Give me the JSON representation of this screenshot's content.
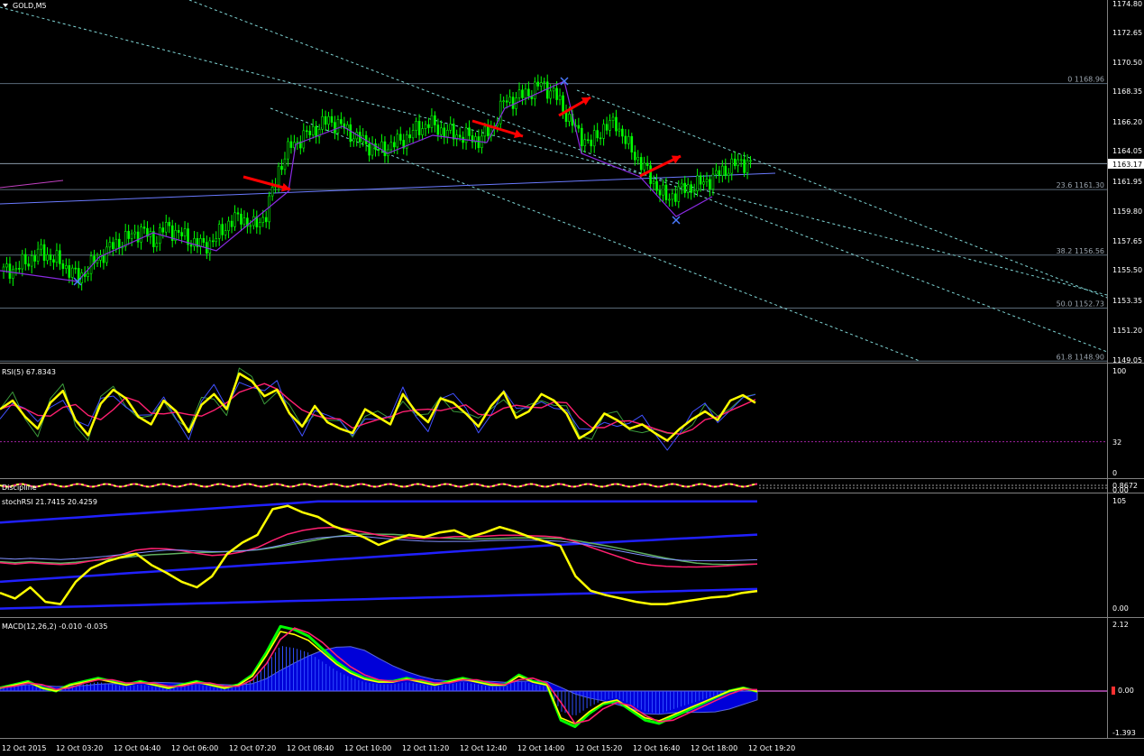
{
  "symbol_label": "GOLD,M5",
  "panels": {
    "main": {
      "price_axis": [
        "1174.80",
        "1172.65",
        "1170.50",
        "1168.35",
        "1166.20",
        "1164.05",
        "1161.95",
        "1159.80",
        "1157.65",
        "1155.50",
        "1153.35",
        "1151.20",
        "1149.05"
      ],
      "current_price": "1163.17",
      "fib_labels": [
        "0 1168.96",
        "23.6 1161.30",
        "38.2 1156.56",
        "50.0 1152.73",
        "61.8 1148.90"
      ]
    },
    "rsi": {
      "title": "RSI(5) 67.8343",
      "axis": [
        "100",
        "32",
        "0"
      ]
    },
    "strip": {
      "label": "Discipline",
      "axis": [
        "0.8672",
        "0.00"
      ]
    },
    "stoch": {
      "title": "stochRSI 21.7415 20.4259",
      "axis": [
        "105",
        "0.00"
      ]
    },
    "macd": {
      "title": "MACD(12,26,2) -0.010 -0.035",
      "axis": [
        "2.12",
        "0.00",
        "-1.393"
      ]
    }
  },
  "time_axis": [
    "12 Oct 2015",
    "12 Oct 03:20",
    "12 Oct 04:40",
    "12 Oct 06:00",
    "12 Oct 07:20",
    "12 Oct 08:40",
    "12 Oct 10:00",
    "12 Oct 11:20",
    "12 Oct 12:40",
    "12 Oct 14:00",
    "12 Oct 15:20",
    "12 Oct 16:40",
    "12 Oct 18:00",
    "12 Oct 19:20"
  ],
  "colors": {
    "up_candle": "#00ff00",
    "zigzag": "#8a2be2",
    "arrow": "#ff0000",
    "channel": "#7fd4d4",
    "rsi_main": "#ffff00",
    "macd_hist": "#0000ff"
  },
  "chart_data": [
    {
      "type": "candlestick",
      "series": [
        {
          "name": "GOLD,M5",
          "values": [
            1155.4,
            1155.6,
            1156.2,
            1156.8,
            1156.3,
            1155.7,
            1154.9,
            1155.8,
            1156.7,
            1157.4,
            1157.8,
            1158.4,
            1157.6,
            1158.6,
            1158.1,
            1157.6,
            1157.2,
            1157.8,
            1158.9,
            1159.3,
            1158.6,
            1159.5,
            1162.8,
            1164.5,
            1165.1,
            1165.7,
            1166.3,
            1165.9,
            1165.2,
            1164.6,
            1164.1,
            1164.5,
            1164.9,
            1165.6,
            1166.1,
            1165.6,
            1165.3,
            1165.1,
            1164.9,
            1165.6,
            1167.6,
            1167.9,
            1168.3,
            1168.9,
            1168.3,
            1166.8,
            1165.3,
            1164.6,
            1165.8,
            1166.1,
            1164.4,
            1163.2,
            1161.8,
            1160.6,
            1161.2,
            1161.5,
            1161.8,
            1162.3,
            1162.9,
            1163.3,
            1163.17
          ]
        }
      ],
      "ylim": [
        1149.05,
        1174.8
      ],
      "fib_levels": [
        1168.96,
        1161.3,
        1156.56,
        1152.73,
        1148.9
      ]
    },
    {
      "type": "line",
      "title": "RSI(5) 67.8343",
      "ylim": [
        0,
        100
      ],
      "series": [
        {
          "name": "RSI(5)",
          "values": [
            62,
            70,
            55,
            44,
            68,
            79,
            52,
            38,
            67,
            80,
            72,
            55,
            48,
            70,
            60,
            41,
            66,
            76,
            62,
            95,
            88,
            74,
            80,
            58,
            46,
            65,
            50,
            44,
            40,
            62,
            55,
            48,
            76,
            60,
            50,
            72,
            68,
            58,
            46,
            65,
            78,
            54,
            60,
            76,
            70,
            58,
            35,
            42,
            58,
            52,
            44,
            48,
            40,
            33,
            44,
            53,
            60,
            52,
            70,
            75,
            67.8343
          ]
        }
      ]
    },
    {
      "type": "line",
      "title": "stochRSI 21.7415 20.4259",
      "ylim": [
        0,
        105
      ],
      "series": [
        {
          "name": "stochRSI",
          "values": [
            20,
            15,
            25,
            12,
            10,
            30,
            42,
            48,
            52,
            55,
            45,
            38,
            30,
            25,
            35,
            55,
            65,
            72,
            95,
            98,
            92,
            88,
            80,
            75,
            70,
            63,
            68,
            72,
            70,
            74,
            76,
            70,
            74,
            79,
            75,
            70,
            66,
            62,
            35,
            22,
            18,
            15,
            12,
            10,
            10,
            12,
            14,
            16,
            17,
            20,
            21.7415
          ]
        }
      ]
    },
    {
      "type": "bar",
      "title": "MACD(12,26,2) -0.010 -0.035",
      "ylim": [
        -1.393,
        2.12
      ],
      "series": [
        {
          "name": "MACD",
          "values": [
            0.1,
            0.2,
            0.3,
            0.1,
            0.0,
            0.2,
            0.3,
            0.4,
            0.3,
            0.2,
            0.3,
            0.2,
            0.1,
            0.2,
            0.3,
            0.2,
            0.1,
            0.2,
            0.5,
            1.2,
            2.0,
            1.9,
            1.7,
            1.3,
            0.9,
            0.6,
            0.4,
            0.3,
            0.3,
            0.4,
            0.3,
            0.2,
            0.3,
            0.4,
            0.3,
            0.2,
            0.2,
            0.5,
            0.3,
            0.2,
            -0.9,
            -1.1,
            -0.7,
            -0.4,
            -0.3,
            -0.6,
            -0.9,
            -1.0,
            -0.8,
            -0.6,
            -0.4,
            -0.2,
            0.0,
            0.1,
            -0.01
          ]
        }
      ]
    }
  ]
}
